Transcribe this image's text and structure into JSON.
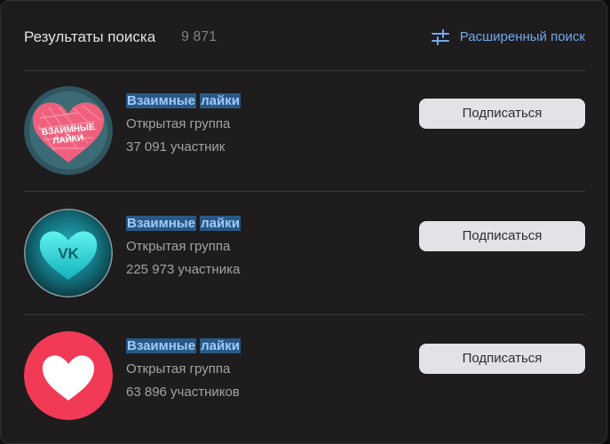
{
  "header": {
    "title": "Результаты поиска",
    "count": "9 871",
    "advanced_search_label": "Расширенный поиск",
    "advanced_search_icon": "filter-sliders-icon"
  },
  "colors": {
    "background": "#1e1c1d",
    "link": "#71aaeb",
    "highlight": "#2a5885",
    "button_bg": "#e1e3e6",
    "muted_text": "#a3a3a5"
  },
  "results": [
    {
      "name_words": [
        "Взаимные",
        "лайки"
      ],
      "type": "Открытая группа",
      "members": "37 091 участник",
      "button_label": "Подписаться",
      "avatar_icon": "pink-scribble-heart-icon",
      "avatar_text": [
        "ВЗАИМНЫЕ",
        "ЛАЙКИ"
      ]
    },
    {
      "name_words": [
        "Взаимные",
        "лайки"
      ],
      "type": "Открытая группа",
      "members": "225 973 участника",
      "button_label": "Подписаться",
      "avatar_icon": "vk-heart-icon",
      "avatar_text": [
        "VK"
      ]
    },
    {
      "name_words": [
        "Взаимные",
        "лайки"
      ],
      "type": "Открытая группа",
      "members": "63 896 участников",
      "button_label": "Подписаться",
      "avatar_icon": "white-heart-icon"
    }
  ]
}
